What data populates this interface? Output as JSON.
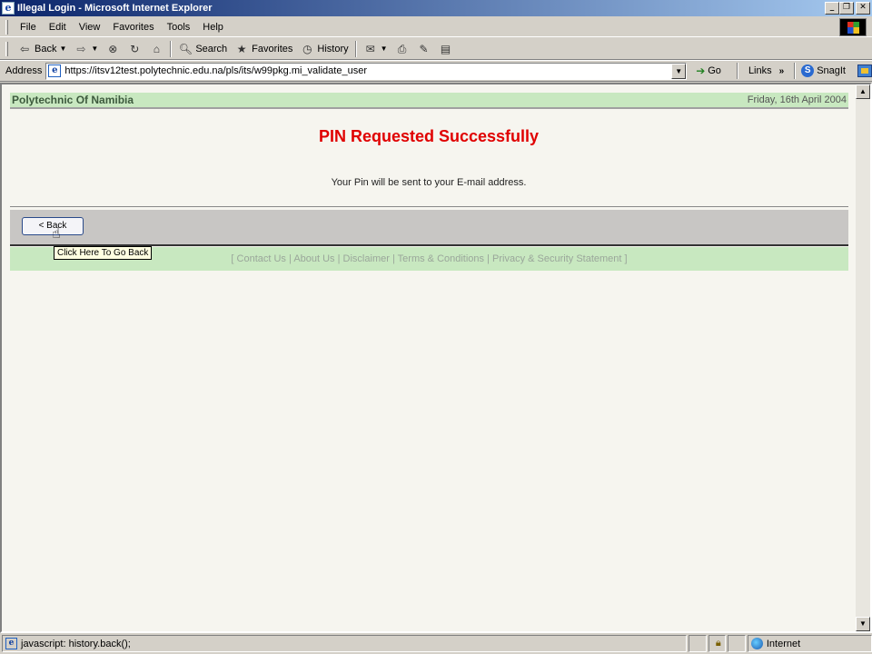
{
  "window": {
    "title": "Illegal Login - Microsoft Internet Explorer",
    "app_icon": "ie-icon",
    "minimize_label": "_",
    "restore_label": "❐",
    "close_label": "✕"
  },
  "menu": {
    "items": [
      "File",
      "Edit",
      "View",
      "Favorites",
      "Tools",
      "Help"
    ]
  },
  "toolbar": {
    "back_label": "Back",
    "search_label": "Search",
    "favorites_label": "Favorites",
    "history_label": "History"
  },
  "address": {
    "label": "Address",
    "url": "https://itsv12test.polytechnic.edu.na/pls/its/w99pkg.mi_validate_user",
    "go_label": "Go",
    "links_label": "Links",
    "snagit_label": "SnagIt"
  },
  "page": {
    "org_name": "Polytechnic Of Namibia",
    "date": "Friday, 16th April 2004",
    "title": "PIN Requested Successfully",
    "message": "Your Pin will be sent to your E-mail address.",
    "back_button": "< Back",
    "tooltip": "Click Here To Go Back",
    "footer": {
      "open": "[ ",
      "contact": "Contact Us",
      "about": "About Us",
      "disclaimer": "Disclaimer",
      "terms": "Terms & Conditions",
      "privacy": "Privacy & Security Statement",
      "sep": " | ",
      "close": " ]"
    }
  },
  "status": {
    "text": "javascript: history.back();",
    "zone": "Internet"
  },
  "colors": {
    "title_red": "#e00000",
    "header_green": "#c8e8c0",
    "nav_gray": "#c8c6c4"
  }
}
